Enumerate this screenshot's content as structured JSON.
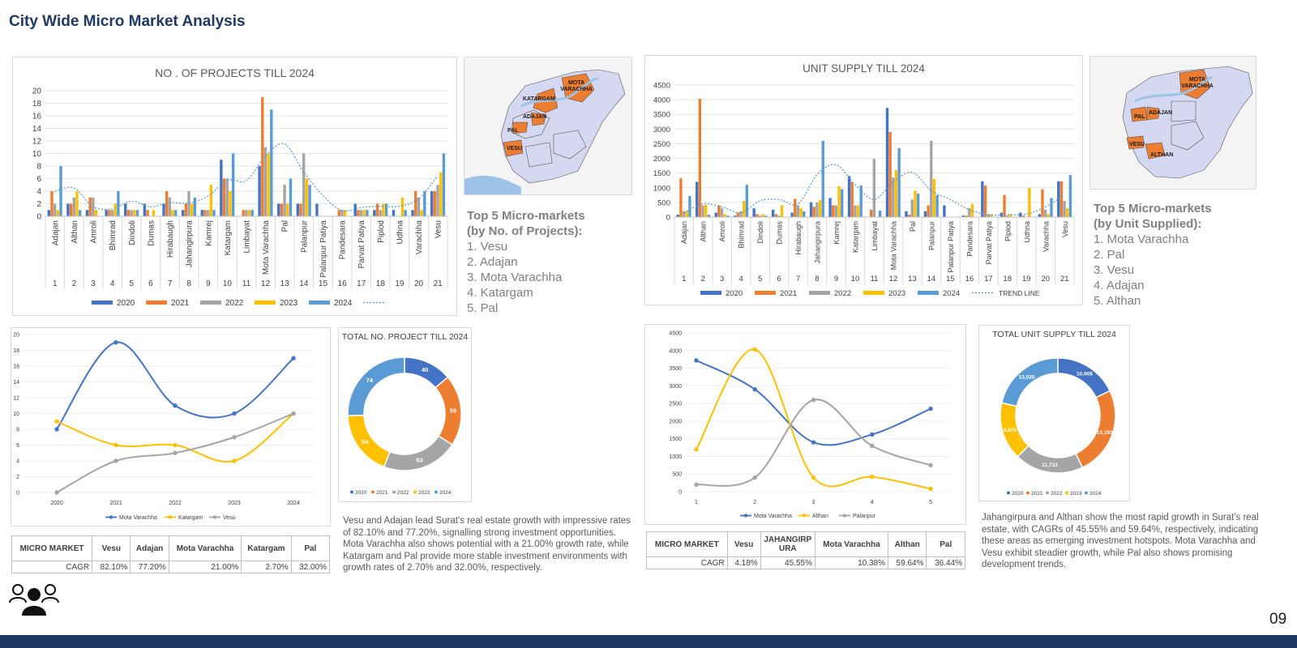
{
  "page": {
    "title": "City Wide Micro Market Analysis",
    "page_number": "09"
  },
  "colors": {
    "y2020": "#4472c4",
    "y2021": "#ed7d31",
    "y2022": "#a5a5a5",
    "y2023": "#ffc000",
    "y2024": "#5b9bd5",
    "navy": "#1f3864",
    "map_fill": "#d4d8f0",
    "map_highlight": "#ed7d31",
    "river": "#9dc3e6"
  },
  "projects_bar": {
    "title": "NO . OF PROJECTS TILL 2024",
    "legend": [
      "2020",
      "2021",
      "2022",
      "2023",
      "2024"
    ],
    "trend_label": ""
  },
  "supply_bar": {
    "title": "UNIT SUPPLY TILL 2024",
    "legend": [
      "2020",
      "2021",
      "2022",
      "2023",
      "2024"
    ],
    "trend_label": "TREND LINE"
  },
  "top5_projects": {
    "heading_1": "Top 5 Micro-markets",
    "heading_2": "(by No. of Projects):",
    "items": [
      "1.  Vesu",
      "2.  Adajan",
      "3.  Mota Varachha",
      "4.  Katargam",
      "5.  Pal"
    ]
  },
  "top5_supply": {
    "heading_1": "Top 5 Micro-markets",
    "heading_2": "(by Unit Supplied):",
    "items": [
      "1. Mota Varachha",
      "2. Pal",
      "3. Vesu",
      "4. Adajan",
      "5. Althan"
    ]
  },
  "map_left": {
    "labels": [
      "MOTA VARACHHA",
      "KATARGAM",
      "ADAJAN",
      "PAL",
      "VESU"
    ]
  },
  "map_right": {
    "labels": [
      "MOTA VARACHHA",
      "PAL",
      "ADAJAN",
      "VESU",
      "ALTHAN"
    ]
  },
  "projects_donut": {
    "title": "TOTAL NO. PROJECT TILL 2024",
    "legend": [
      "2020",
      "2021",
      "2022",
      "2023",
      "2024"
    ]
  },
  "supply_donut": {
    "title": "TOTAL UNIT SUPPLY TILL 2024",
    "legend": [
      "2020",
      "2021",
      "2022",
      "2023",
      "2024"
    ]
  },
  "projects_line_legend": [
    "Mota Varachha",
    "Katargam",
    "Vesu"
  ],
  "supply_line_legend": [
    "Mota Varachha",
    "Althan",
    "Palanpur"
  ],
  "projects_cagr_table": {
    "headers": [
      "MICRO MARKET",
      "Vesu",
      "Adajan",
      "Mota Varachha",
      "Katargam",
      "Pal"
    ],
    "row_label": "CAGR",
    "values": [
      "82.10%",
      "77.20%",
      "21.00%",
      "2.70%",
      "32.00%"
    ]
  },
  "supply_cagr_table": {
    "headers": [
      "MICRO MARKET",
      "Vesu",
      "JAHANGIRPURA",
      "Mota Varachha",
      "Althan",
      "Pal"
    ],
    "row_label": "CAGR",
    "values": [
      "4.18%",
      "45.55%",
      "10.38%",
      "59.64%",
      "36.44%"
    ]
  },
  "projects_paragraph": "Vesu and Adajan lead Surat's real estate growth with impressive rates of 82.10% and 77.20%, signalling strong investment opportunities. Mota Varachha also shows potential with a 21.00% growth rate, while Katargam and Pal provide more stable investment environments with growth rates of 2.70% and 32.00%, respectively.",
  "supply_paragraph": "Jahangirpura and Althan show the most rapid growth in Surat's real estate, with CAGRs of 45.55% and 59.64%, respectively, indicating these areas as emerging investment hotspots. Mota Varachha and Vesu exhibit steadier growth, while Pal also shows promising development trends.",
  "chart_data": [
    {
      "type": "bar",
      "title": "NO . OF PROJECTS TILL 2024",
      "categories": [
        "Adajan",
        "Althan",
        "Amroli",
        "Bhimrad",
        "Dindoli",
        "Dumas",
        "Hirabaugh",
        "Jahangirpura",
        "Kamrej",
        "Katargam",
        "Limbayat",
        "Mota Varachha",
        "Pal",
        "Palanpur",
        "Palanpur Patiya",
        "Pandesara",
        "Parvat Patiya",
        "Piplod",
        "Udhna",
        "Varachha",
        "Vesu"
      ],
      "category_numbers": [
        "1",
        "2",
        "3",
        "4",
        "5",
        "6",
        "7",
        "8",
        "9",
        "10",
        "11",
        "12",
        "13",
        "14",
        "15",
        "16",
        "17",
        "18",
        "19",
        "20",
        "21"
      ],
      "ylim": [
        0,
        20
      ],
      "yticks": [
        "0",
        "2",
        "4",
        "6",
        "8",
        "10",
        "12",
        "14",
        "16",
        "18",
        "20"
      ],
      "series": [
        {
          "name": "2020",
          "values": [
            1,
            2,
            1,
            1,
            2,
            2,
            2,
            1,
            1,
            9,
            0,
            8,
            2,
            2,
            2,
            0,
            2,
            1,
            1,
            1,
            4
          ]
        },
        {
          "name": "2021",
          "values": [
            4,
            2,
            3,
            1,
            1,
            1,
            4,
            2,
            1,
            6,
            1,
            19,
            2,
            2,
            0,
            1,
            1,
            2,
            0,
            4,
            4
          ]
        },
        {
          "name": "2022",
          "values": [
            2,
            3,
            3,
            1,
            1,
            0,
            3,
            4,
            1,
            6,
            1,
            11,
            5,
            10,
            0,
            1,
            1,
            1,
            0,
            3,
            5
          ]
        },
        {
          "name": "2023",
          "values": [
            1,
            4,
            1,
            2,
            1,
            1,
            1,
            2,
            5,
            4,
            1,
            10,
            2,
            6,
            0,
            1,
            1,
            2,
            3,
            1,
            7
          ]
        },
        {
          "name": "2024",
          "values": [
            8,
            1,
            0,
            4,
            1,
            0,
            1,
            3,
            1,
            10,
            1,
            17,
            6,
            5,
            0,
            0,
            1,
            2,
            1,
            4,
            10
          ]
        }
      ],
      "trend": [
        4.0,
        4.5,
        1.5,
        1.2,
        2.4,
        1.5,
        2.2,
        2.1,
        3.2,
        5.7,
        5.7,
        9.6,
        11.5,
        7.0,
        3.3,
        0.9,
        1.4,
        1.6,
        1.6,
        2.8,
        6.5
      ]
    },
    {
      "type": "bar",
      "title": "UNIT SUPPLY TILL 2024",
      "categories": [
        "Adajan",
        "Althan",
        "Amroli",
        "Bhimrad",
        "Dindoli",
        "Dumas",
        "Hirabaugh",
        "Jahangirpura",
        "Kamrej",
        "Katargam",
        "Limbayat",
        "Mota Varachha",
        "Pal",
        "Palanpur",
        "Palanpur Patiya",
        "Pandesara",
        "Parvat Patiya",
        "Piplod",
        "Udhna",
        "Varachha",
        "Vesu"
      ],
      "category_numbers": [
        "1",
        "2",
        "3",
        "4",
        "5",
        "6",
        "7",
        "8",
        "9",
        "10",
        "11",
        "12",
        "13",
        "14",
        "15",
        "16",
        "17",
        "18",
        "19",
        "20",
        "21"
      ],
      "ylim": [
        0,
        4500
      ],
      "yticks": [
        "0",
        "500",
        "1000",
        "1500",
        "2000",
        "2500",
        "3000",
        "3500",
        "4000",
        "4500"
      ],
      "series": [
        {
          "name": "2020",
          "values": [
            80,
            1200,
            150,
            50,
            300,
            250,
            150,
            500,
            650,
            1400,
            0,
            3720,
            200,
            200,
            400,
            50,
            1220,
            150,
            150,
            100,
            1220
          ]
        },
        {
          "name": "2021",
          "values": [
            1320,
            4030,
            400,
            150,
            100,
            100,
            620,
            350,
            400,
            1200,
            250,
            2900,
            80,
            400,
            0,
            50,
            1080,
            750,
            50,
            950,
            1220
          ]
        },
        {
          "name": "2022",
          "values": [
            200,
            400,
            300,
            200,
            50,
            50,
            400,
            500,
            400,
            400,
            1980,
            1350,
            600,
            2600,
            0,
            300,
            100,
            50,
            0,
            250,
            550
          ]
        },
        {
          "name": "2023",
          "values": [
            200,
            420,
            100,
            550,
            100,
            400,
            300,
            580,
            1050,
            400,
            0,
            1600,
            900,
            1300,
            0,
            450,
            100,
            100,
            1000,
            100,
            300
          ]
        },
        {
          "name": "2024",
          "values": [
            720,
            80,
            50,
            1100,
            50,
            0,
            200,
            2600,
            950,
            1080,
            220,
            2350,
            800,
            750,
            0,
            0,
            0,
            0,
            0,
            650,
            1430
          ]
        }
      ],
      "trend": [
        150,
        450,
        350,
        150,
        560,
        600,
        450,
        1450,
        1780,
        1100,
        600,
        1200,
        1520,
        900,
        600,
        250,
        80,
        80,
        100,
        350,
        750
      ]
    },
    {
      "type": "line",
      "title": "",
      "x": [
        "2020",
        "2021",
        "2022",
        "2023",
        "2024"
      ],
      "ylim": [
        0,
        20
      ],
      "yticks": [
        "0",
        "2",
        "4",
        "6",
        "8",
        "10",
        "12",
        "14",
        "16",
        "18",
        "20"
      ],
      "series": [
        {
          "name": "Mota Varachha",
          "values": [
            8,
            19,
            11,
            10,
            17
          ]
        },
        {
          "name": "Katargam",
          "values": [
            9,
            6,
            6,
            4,
            10
          ]
        },
        {
          "name": "Vesu",
          "values": [
            0,
            4,
            5,
            7,
            10
          ]
        }
      ]
    },
    {
      "type": "line",
      "title": "",
      "x": [
        "1",
        "2",
        "3",
        "4",
        "5"
      ],
      "ylim": [
        0,
        4500
      ],
      "yticks": [
        "0",
        "500",
        "1000",
        "1500",
        "2000",
        "2500",
        "3000",
        "3500",
        "4000",
        "4500"
      ],
      "series": [
        {
          "name": "Mota Varachha",
          "values": [
            3720,
            2900,
            1400,
            1620,
            2350
          ]
        },
        {
          "name": "Althan",
          "values": [
            1200,
            4030,
            400,
            420,
            80
          ]
        },
        {
          "name": "Palanpur",
          "values": [
            200,
            400,
            2600,
            1300,
            750
          ]
        }
      ]
    },
    {
      "type": "pie",
      "title": "TOTAL NO. PROJECT TILL 2024",
      "donut": true,
      "labels": [
        "2020",
        "2021",
        "2022",
        "2023",
        "2024"
      ],
      "values": [
        40,
        59,
        63,
        54,
        74
      ]
    },
    {
      "type": "pie",
      "title": "TOTAL UNIT SUPPLY TILL 2024",
      "donut": true,
      "labels": [
        "2020",
        "2021",
        "2022",
        "2023",
        "2024"
      ],
      "values": [
        10908,
        15193,
        11733,
        9876,
        13020
      ],
      "value_labels": [
        "10,908",
        "15,193",
        "11,733",
        "9,876",
        "13,020"
      ]
    }
  ]
}
